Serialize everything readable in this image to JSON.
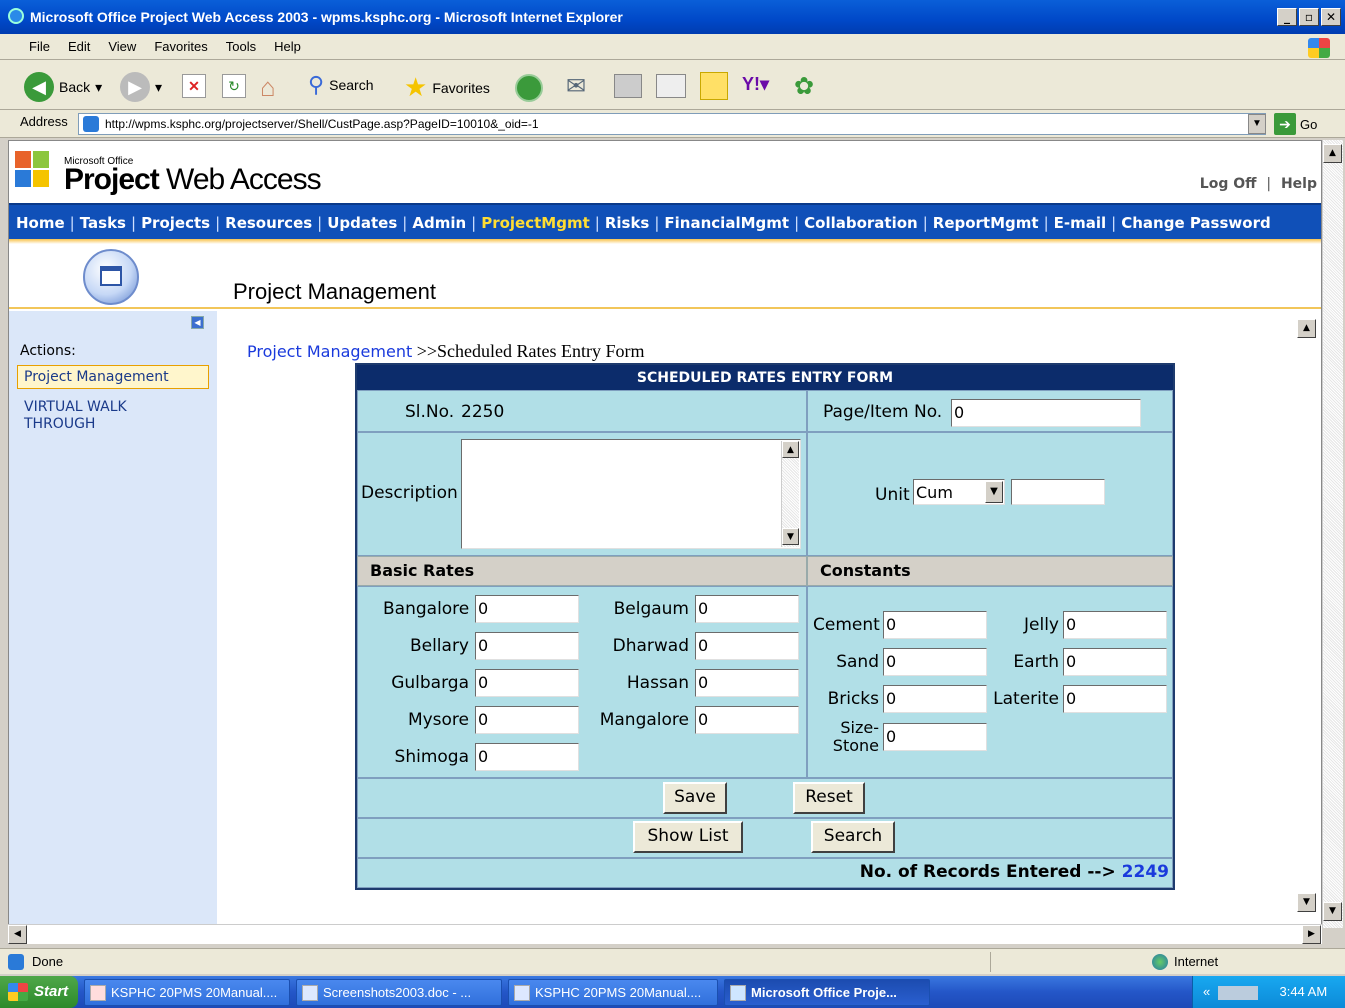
{
  "window": {
    "title": "Microsoft Office Project Web Access 2003 - wpms.ksphc.org - Microsoft Internet Explorer"
  },
  "menu": [
    "File",
    "Edit",
    "View",
    "Favorites",
    "Tools",
    "Help"
  ],
  "toolbar": {
    "back": "Back",
    "search": "Search",
    "favorites": "Favorites"
  },
  "address": {
    "label": "Address",
    "url": "http://wpms.ksphc.org/projectserver/Shell/CustPage.asp?PageID=10010&_oid=-1",
    "go": "Go"
  },
  "header": {
    "brand_small": "Microsoft Office",
    "brand_bold": "Project",
    "brand_rest": " Web Access",
    "logoff": "Log Off",
    "help": "Help",
    "sep": "|"
  },
  "nav": [
    "Home",
    "Tasks",
    "Projects",
    "Resources",
    "Updates",
    "Admin",
    "ProjectMgmt",
    "Risks",
    "FinancialMgmt",
    "Collaboration",
    "ReportMgmt",
    "E-mail",
    "Change Password"
  ],
  "nav_active": "ProjectMgmt",
  "page": {
    "title": "Project Management"
  },
  "sidebar": {
    "actions_label": "Actions:",
    "items": [
      "Project Management",
      "VIRTUAL WALK THROUGH"
    ]
  },
  "breadcrumb": {
    "link": "Project Management",
    "rest": " >>Scheduled Rates Entry Form"
  },
  "form": {
    "heading": "SCHEDULED RATES ENTRY FORM",
    "slno_label": "Sl.No.",
    "slno_value": "2250",
    "page_item_label": "Page/Item No.",
    "page_item_value": "0",
    "description_label": "Description",
    "description_value": "",
    "unit_label": "Unit",
    "unit_selected": "Cum",
    "unit_extra": "",
    "basic_rates_head": "Basic Rates",
    "constants_head": "Constants",
    "basic_rates": [
      {
        "label": "Bangalore",
        "value": "0"
      },
      {
        "label": "Belgaum",
        "value": "0"
      },
      {
        "label": "Bellary",
        "value": "0"
      },
      {
        "label": "Dharwad",
        "value": "0"
      },
      {
        "label": "Gulbarga",
        "value": "0"
      },
      {
        "label": "Hassan",
        "value": "0"
      },
      {
        "label": "Mysore",
        "value": "0"
      },
      {
        "label": "Mangalore",
        "value": "0"
      },
      {
        "label": "Shimoga",
        "value": "0"
      }
    ],
    "constants": [
      {
        "label": "Cement",
        "value": "0"
      },
      {
        "label": "Jelly",
        "value": "0"
      },
      {
        "label": "Sand",
        "value": "0"
      },
      {
        "label": "Earth",
        "value": "0"
      },
      {
        "label": "Bricks",
        "value": "0"
      },
      {
        "label": "Laterite",
        "value": "0"
      },
      {
        "label": "Size-\nStone",
        "value": "0"
      }
    ],
    "save": "Save",
    "reset": "Reset",
    "show_list": "Show List",
    "search": "Search",
    "records_label": "No. of Records Entered -->",
    "records_count": "2249"
  },
  "status": {
    "text": "Done",
    "zone": "Internet"
  },
  "taskbar": {
    "start": "Start",
    "tasks": [
      "KSPHC 20PMS 20Manual....",
      "Screenshots2003.doc - ...",
      "KSPHC 20PMS 20Manual....",
      "Microsoft Office Proje..."
    ],
    "clock": "3:44 AM"
  },
  "colors": {
    "nav_bg": "#1050b8",
    "nav_active": "#ffdd33",
    "form_bg": "#b1dfe7",
    "form_head": "#0c2c6b",
    "sidebar_bg": "#dbe7f9"
  }
}
